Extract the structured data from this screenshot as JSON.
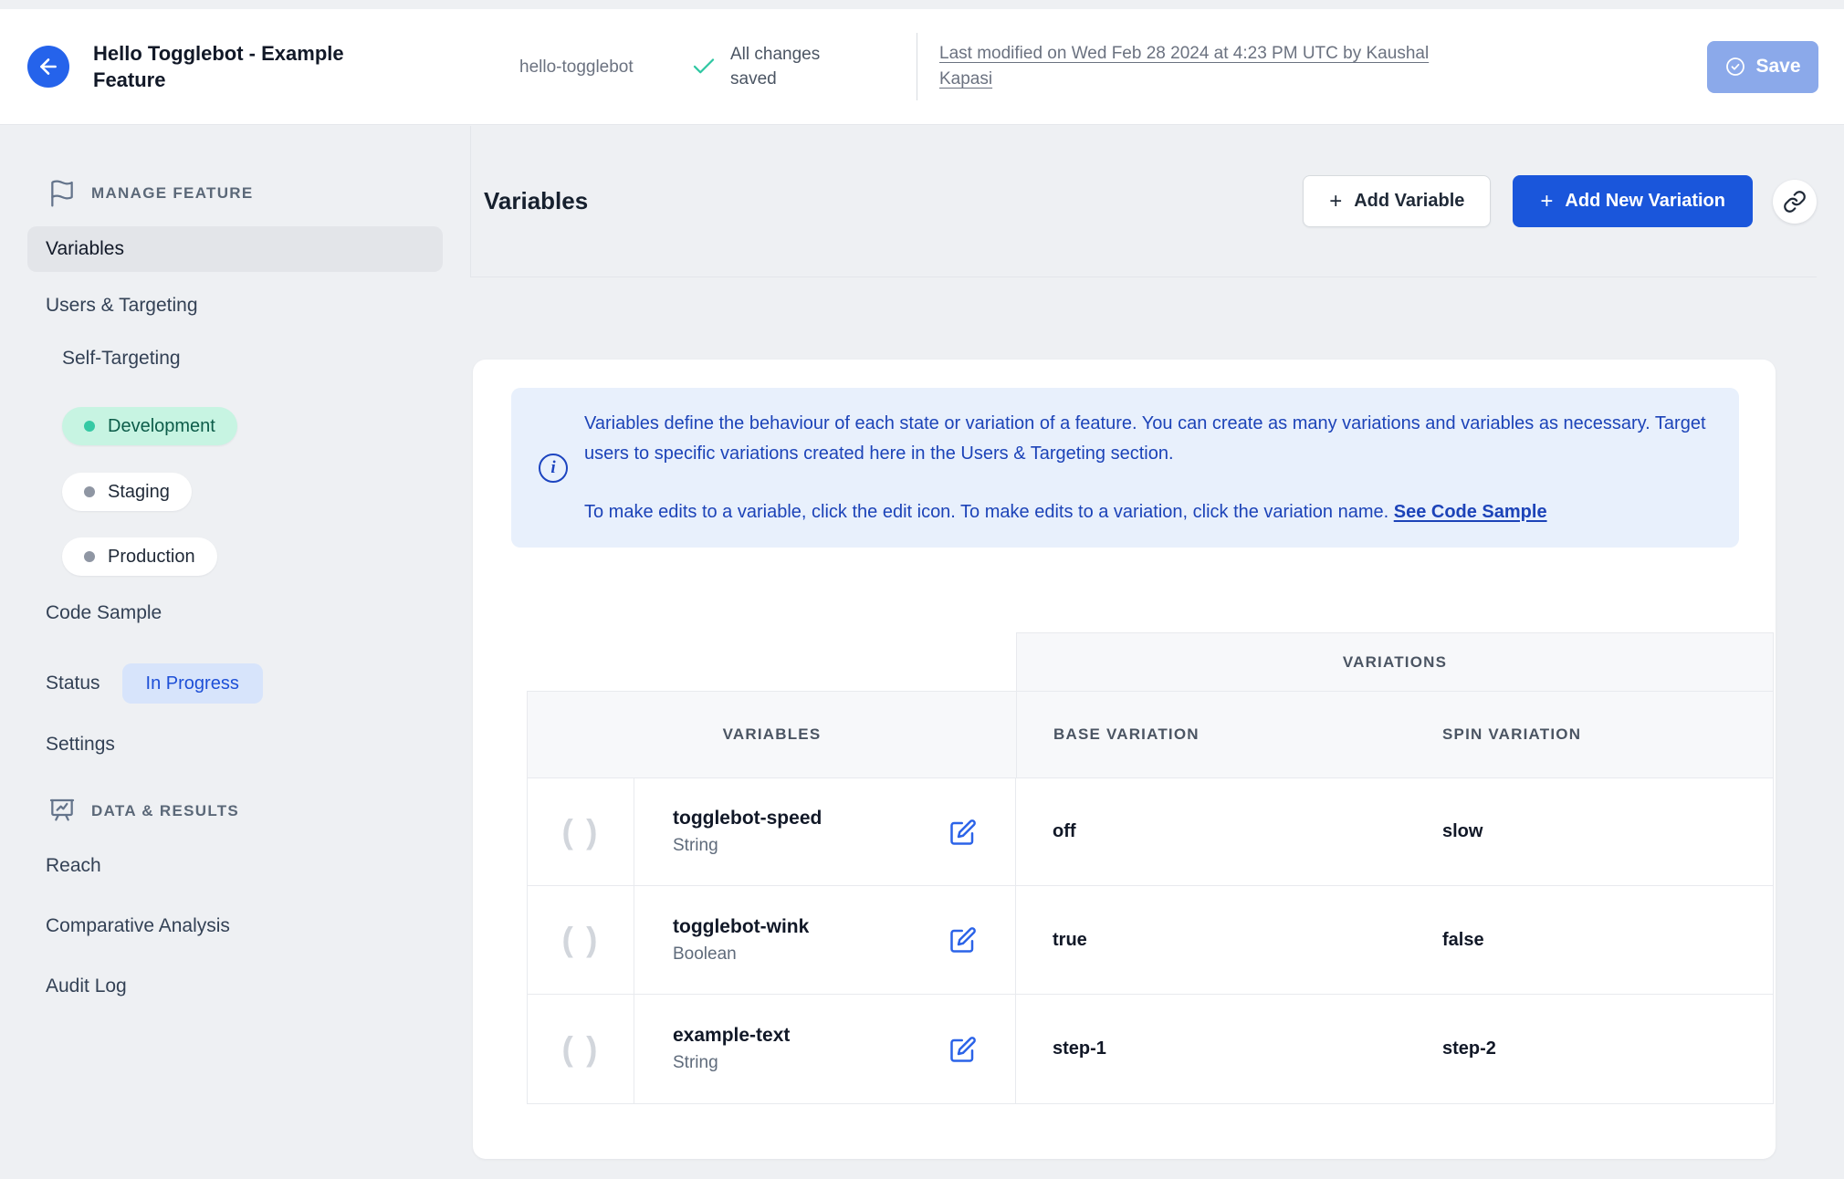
{
  "header": {
    "title": "Hello Togglebot - Example Feature",
    "feature_key": "hello-togglebot",
    "save_status": "All changes saved",
    "last_modified": "Last modified on Wed Feb 28 2024 at 4:23 PM UTC by Kaushal Kapasi",
    "save_label": "Save"
  },
  "sidebar": {
    "manage_section_label": "MANAGE FEATURE",
    "items": {
      "variables": "Variables",
      "users_targeting": "Users & Targeting",
      "self_targeting": "Self-Targeting",
      "code_sample": "Code Sample",
      "status": "Status",
      "settings": "Settings"
    },
    "environments": [
      {
        "name": "Development",
        "active": true
      },
      {
        "name": "Staging",
        "active": false
      },
      {
        "name": "Production",
        "active": false
      }
    ],
    "status_badge": "In Progress",
    "data_section_label": "DATA & RESULTS",
    "data_items": {
      "reach": "Reach",
      "comparative": "Comparative Analysis",
      "audit": "Audit Log"
    }
  },
  "content": {
    "heading": "Variables",
    "add_variable_label": "Add Variable",
    "add_variation_label": "Add New Variation",
    "info": {
      "paragraph1": "Variables define the behaviour of each state or variation of a feature. You can create as many variations and variables as necessary. Target users to specific variations created here in the Users & Targeting section.",
      "paragraph2": "To make edits to a variable, click the edit icon. To make edits to a variation, click the variation name.",
      "link_label": "See Code Sample"
    },
    "table": {
      "variations_header": "VARIATIONS",
      "variables_header": "VARIABLES",
      "base_header": "BASE VARIATION",
      "spin_header": "SPIN VARIATION",
      "rows": [
        {
          "name": "togglebot-speed",
          "type": "String",
          "base": "off",
          "spin": "slow"
        },
        {
          "name": "togglebot-wink",
          "type": "Boolean",
          "base": "true",
          "spin": "false"
        },
        {
          "name": "example-text",
          "type": "String",
          "base": "step-1",
          "spin": "step-2"
        }
      ]
    }
  },
  "icons": {
    "plus": "+",
    "variable_parens": "( )",
    "info_i": "i"
  },
  "colors": {
    "accent_blue": "#1a56db",
    "save_disabled_blue": "#8ba9ea",
    "info_bg": "#e8f0fc",
    "info_text": "#1c43b8",
    "dev_pill_bg": "#c7f4e2",
    "dev_pill_text": "#0c5c49",
    "teal_check": "#2fc7a2",
    "status_badge_bg": "#d7e4fb",
    "status_badge_text": "#1d4fd7",
    "selected_item_bg": "#e3e5e9"
  }
}
